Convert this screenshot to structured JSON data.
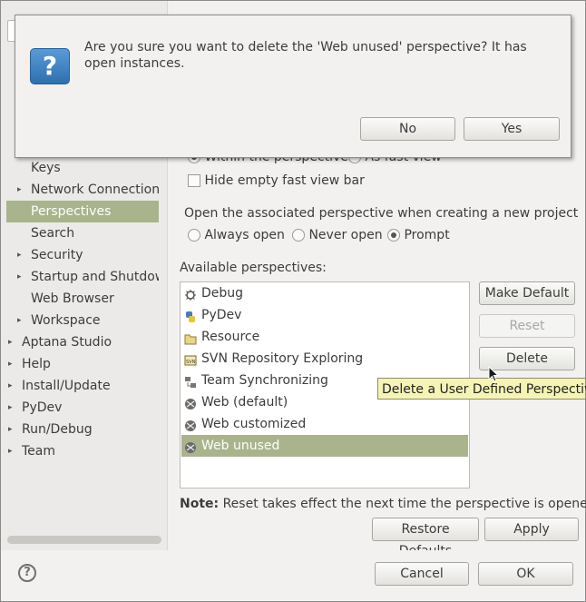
{
  "dialog": {
    "message": "Are you sure you want to delete the 'Web unused' perspective? It has open instances.",
    "no_label": "No",
    "yes_label": "Yes",
    "icon": "question-icon"
  },
  "sidebar": {
    "items": [
      {
        "label": "Keys",
        "arrow": "",
        "indent": 1,
        "selected": false
      },
      {
        "label": "Network Connections",
        "arrow": "▸",
        "indent": 1,
        "selected": false
      },
      {
        "label": "Perspectives",
        "arrow": "",
        "indent": 1,
        "selected": true
      },
      {
        "label": "Search",
        "arrow": "",
        "indent": 1,
        "selected": false
      },
      {
        "label": "Security",
        "arrow": "▸",
        "indent": 1,
        "selected": false
      },
      {
        "label": "Startup and Shutdown",
        "arrow": "▸",
        "indent": 1,
        "selected": false
      },
      {
        "label": "Web Browser",
        "arrow": "",
        "indent": 1,
        "selected": false
      },
      {
        "label": "Workspace",
        "arrow": "▸",
        "indent": 1,
        "selected": false
      },
      {
        "label": "Aptana Studio",
        "arrow": "▸",
        "indent": 0,
        "selected": false
      },
      {
        "label": "Help",
        "arrow": "▸",
        "indent": 0,
        "selected": false
      },
      {
        "label": "Install/Update",
        "arrow": "▸",
        "indent": 0,
        "selected": false
      },
      {
        "label": "PyDev",
        "arrow": "▸",
        "indent": 0,
        "selected": false
      },
      {
        "label": "Run/Debug",
        "arrow": "▸",
        "indent": 0,
        "selected": false
      },
      {
        "label": "Team",
        "arrow": "▸",
        "indent": 0,
        "selected": false
      }
    ]
  },
  "fast_view": {
    "within_label": "Within the perspective",
    "as_fast_view_label": "As fast view",
    "hide_empty_label": "Hide empty fast view bar"
  },
  "open_assoc": {
    "label": "Open the associated perspective when creating a new project",
    "always_open": "Always open",
    "never_open": "Never open",
    "prompt": "Prompt"
  },
  "perspectives": {
    "label": "Available perspectives:",
    "items": [
      {
        "label": "Debug",
        "icon": "bug-icon",
        "selected": false
      },
      {
        "label": "PyDev",
        "icon": "python-icon",
        "selected": false
      },
      {
        "label": "Resource",
        "icon": "folder-icon",
        "selected": false
      },
      {
        "label": "SVN Repository Exploring",
        "icon": "svn-icon",
        "selected": false
      },
      {
        "label": "Team Synchronizing",
        "icon": "sync-icon",
        "selected": false
      },
      {
        "label": "Web (default)",
        "icon": "web-icon",
        "selected": false
      },
      {
        "label": "Web customized",
        "icon": "web-icon",
        "selected": false
      },
      {
        "label": "Web unused",
        "icon": "web-icon",
        "selected": true
      }
    ],
    "make_default_label": "Make Default",
    "reset_label": "Reset",
    "delete_label": "Delete"
  },
  "tooltip": "Delete a User Defined Perspective",
  "note": {
    "bold": "Note:",
    "text": " Reset takes effect the next time the perspective is opened"
  },
  "buttons": {
    "restore_defaults": "Restore Defaults",
    "apply": "Apply",
    "cancel": "Cancel",
    "ok": "OK"
  },
  "colors": {
    "selection": "#a9b38c",
    "tooltip_bg": "#f5f4b6",
    "dialog_icon": "#3f7fbf"
  }
}
